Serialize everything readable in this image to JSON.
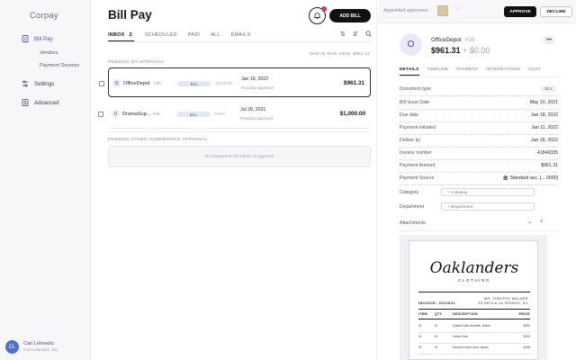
{
  "app": {
    "logo": "Corpay"
  },
  "sidebar": {
    "items": [
      {
        "label": "Bill Pay",
        "icon": "bill-icon"
      },
      {
        "label": "Settings",
        "icon": "sliders-icon"
      },
      {
        "label": "Advanced",
        "icon": "dollar-icon"
      }
    ],
    "sub_items": [
      "Vendors",
      "Payment Sources"
    ],
    "user": {
      "initials": "CL",
      "name": "Carl Lebowitz",
      "org": "Carl Lebowitz, Inc."
    }
  },
  "main": {
    "title": "Bill Pay",
    "add_bill": "ADD BILL",
    "tabs": [
      {
        "label": "INBOX",
        "count": "2"
      },
      {
        "label": "SCHEDULED"
      },
      {
        "label": "PAID"
      },
      {
        "label": "ALL"
      },
      {
        "label": "EMAILS"
      }
    ],
    "sum_label": "SUM IN THIS VIEW: $961.31",
    "pending_my": "PENDING MY APPROVAL",
    "pending_others": "PENDING OTHER COWORKERS' APPROVAL",
    "empty_msg": "No documents for others to approve",
    "rows": [
      {
        "initial": "O",
        "vendor": "OfficeDepot",
        "vid": "#38",
        "pill": "BILL",
        "ref": "41846335",
        "date": "Jan 18, 2022",
        "status": "Pending approval",
        "amount": "$961.31"
      },
      {
        "initial": "D",
        "vendor": "DramaSup...",
        "vid": "#39",
        "pill": "BILL",
        "ref": "#2021",
        "date": "Jul 28, 2021",
        "status": "Pending approval",
        "amount": "$1,000.00"
      }
    ]
  },
  "detail": {
    "approvers_label": "Appointed approvers",
    "approve": "APPROVE",
    "decline": "DECLINE",
    "vendor_initial": "O",
    "vendor": "OfficeDepot",
    "vendor_id": "#38",
    "amount": "$961.31",
    "amount_extra": "+ $0.00",
    "tabs": [
      "DETAILS",
      "TIMELINE",
      "PAYMENT",
      "INTEGRATIONS",
      "CHAT"
    ],
    "fields": [
      {
        "label": "Document type",
        "value": "BILL"
      },
      {
        "label": "Bill Issue Date",
        "value": "May 10, 2021"
      },
      {
        "label": "Due date",
        "value": "Jan 18, 2022"
      },
      {
        "label": "Payment initiated",
        "value": "Jan 11, 2022"
      },
      {
        "label": "Deliver by",
        "value": "Jan 18, 2022"
      },
      {
        "label": "Invoice number",
        "value": "41846335"
      },
      {
        "label": "Payment Amount",
        "value": "$961.31"
      },
      {
        "label": "Payment Source",
        "value": "Standard acc. [....0000]"
      }
    ],
    "category": {
      "label": "Category",
      "placeholder": "+ Category"
    },
    "department": {
      "label": "Department",
      "placeholder": "+ Department"
    },
    "attachments_label": "Attachments",
    "invoice": {
      "brand": "Oaklanders",
      "sub": "CLOTHING",
      "number": "INVOICE: 2012021",
      "addr1": "MR. TIMOTHY WALKER",
      "addr2": "45 DECLA LA SPARKS, NY",
      "headers": [
        "ITEM",
        "QTY",
        "DESCRIPTION",
        "PRICE"
      ],
      "lines": [
        {
          "item": "01",
          "qty": "01",
          "desc": "Quilted Satin Bomber Jacket",
          "price": "$250"
        },
        {
          "item": "01",
          "qty": "01",
          "desc": "Velvet Coat",
          "price": "$230"
        },
        {
          "item": "01",
          "qty": "01",
          "desc": "Hooded Down Liner Jacket",
          "price": "$198"
        }
      ]
    }
  }
}
